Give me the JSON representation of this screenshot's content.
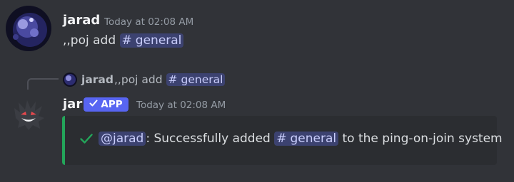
{
  "message1": {
    "username": "jarad",
    "timestamp": "Today at 02:08 AM",
    "prefix": ",,poj add",
    "channel_mention": "general"
  },
  "reply": {
    "username": "jarad",
    "prefix": ",,poj add",
    "channel_mention": "general"
  },
  "message2": {
    "username": "jar",
    "badge_label": "APP",
    "timestamp": "Today at 02:08 AM",
    "embed": {
      "user_mention": "@jarad",
      "text_before_channel": ": Successfully added",
      "channel_mention": "general",
      "text_after_channel": "to the ping-on-join system",
      "accent_color": "#23a55a"
    }
  },
  "colors": {
    "background": "#313338",
    "mention_bg": "#3c4270",
    "mention_text": "#c9cdfb",
    "app_badge": "#5865f2",
    "embed_bg": "#2b2d31"
  },
  "icons": {
    "channel": "hash-icon",
    "verified": "checkmark-icon",
    "success": "checkmark-icon"
  }
}
